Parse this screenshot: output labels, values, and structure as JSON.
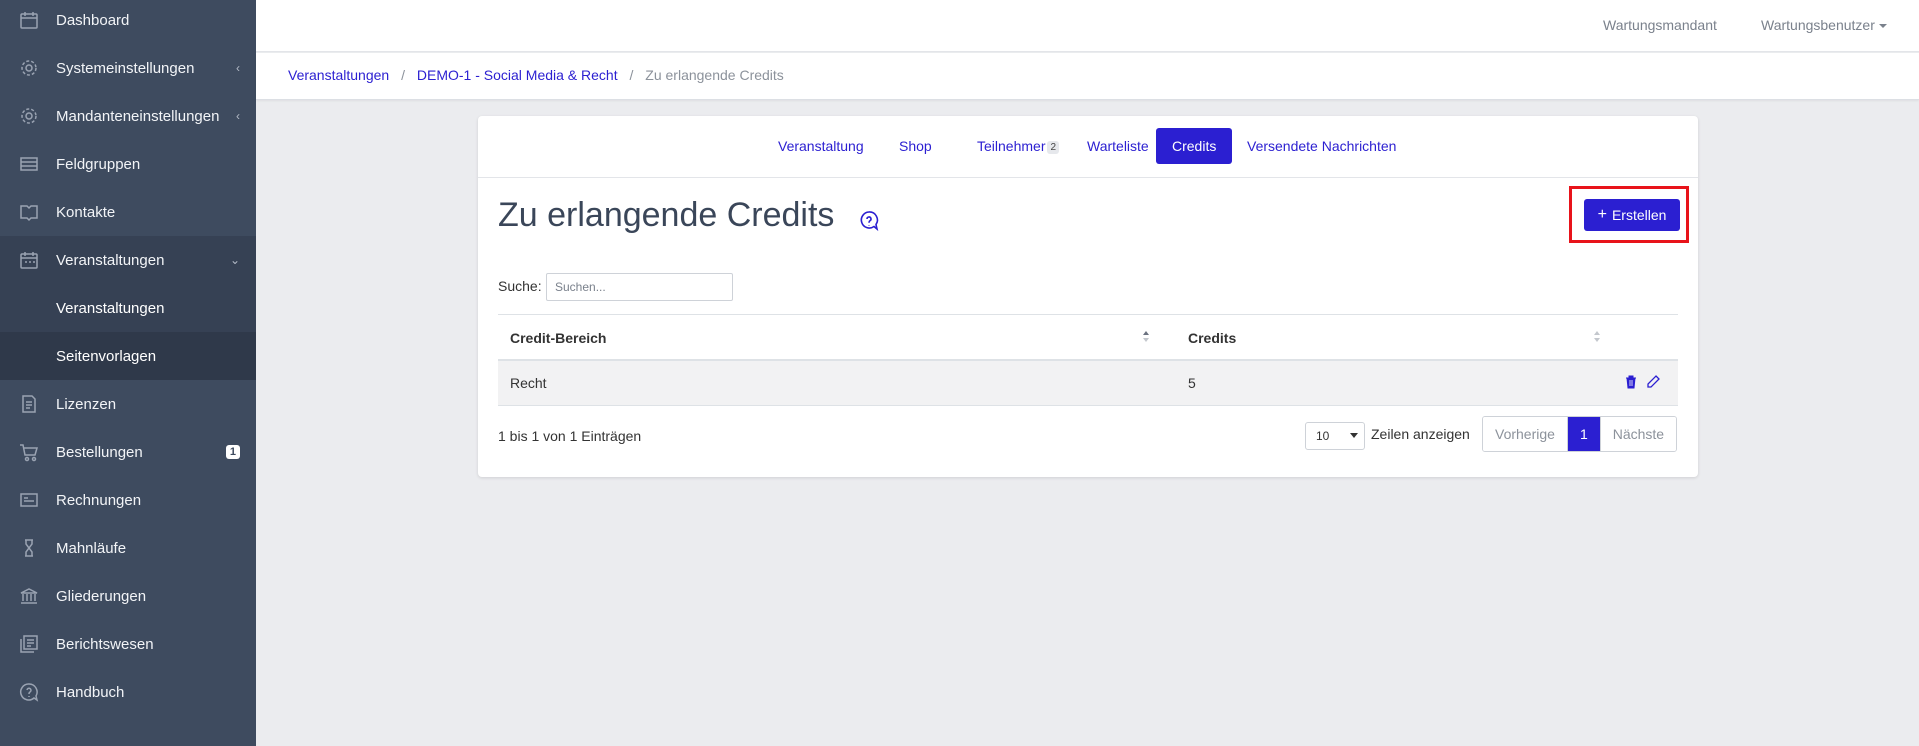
{
  "sidebar": {
    "items": [
      {
        "label": "Dashboard",
        "icon": "calendar-icon"
      },
      {
        "label": "Systemeinstellungen",
        "icon": "gear-icon",
        "chevron": "‹"
      },
      {
        "label": "Mandanteneinstellungen",
        "icon": "gear-icon",
        "chevron": "‹"
      },
      {
        "label": "Feldgruppen",
        "icon": "list-icon"
      },
      {
        "label": "Kontakte",
        "icon": "book-icon"
      },
      {
        "label": "Veranstaltungen",
        "icon": "calendar-icon",
        "chevron": "⌄"
      },
      {
        "label": "Lizenzen",
        "icon": "document-icon"
      },
      {
        "label": "Bestellungen",
        "icon": "cart-icon",
        "badge": "1"
      },
      {
        "label": "Rechnungen",
        "icon": "invoice-icon"
      },
      {
        "label": "Mahnläufe",
        "icon": "hourglass-icon"
      },
      {
        "label": "Gliederungen",
        "icon": "bank-icon"
      },
      {
        "label": "Berichtswesen",
        "icon": "report-icon"
      },
      {
        "label": "Handbuch",
        "icon": "help-icon"
      }
    ],
    "subitems": [
      {
        "label": "Veranstaltungen"
      },
      {
        "label": "Seitenvorlagen"
      }
    ]
  },
  "topbar": {
    "tenant": "Wartungsmandant",
    "user": "Wartungsbenutzer"
  },
  "breadcrumb": {
    "items": [
      "Veranstaltungen",
      "DEMO-1 - Social Media & Recht"
    ],
    "current": "Zu erlangende Credits"
  },
  "tabs": [
    {
      "label": "Veranstaltung"
    },
    {
      "label": "Shop"
    },
    {
      "label": "Teilnehmer",
      "badge": "2"
    },
    {
      "label": "Warteliste"
    },
    {
      "label": "Credits",
      "active": true
    },
    {
      "label": "Versendete Nachrichten"
    }
  ],
  "page": {
    "title": "Zu erlangende Credits",
    "create_label": "Erstellen",
    "create_plus": "+"
  },
  "search": {
    "label": "Suche:",
    "placeholder": "Suchen...",
    "value": ""
  },
  "table": {
    "columns": [
      "Credit-Bereich",
      "Credits"
    ],
    "rows": [
      [
        "Recht",
        "5"
      ]
    ]
  },
  "footer": {
    "info": "1 bis 1 von 1 Einträgen",
    "page_length": "10",
    "length_label": "Zeilen anzeigen",
    "prev": "Vorherige",
    "page": "1",
    "next": "Nächste"
  },
  "colors": {
    "accent": "#2b1fd1",
    "sidebar_bg": "#3e4b5f",
    "highlight_box": "#e8131a"
  }
}
